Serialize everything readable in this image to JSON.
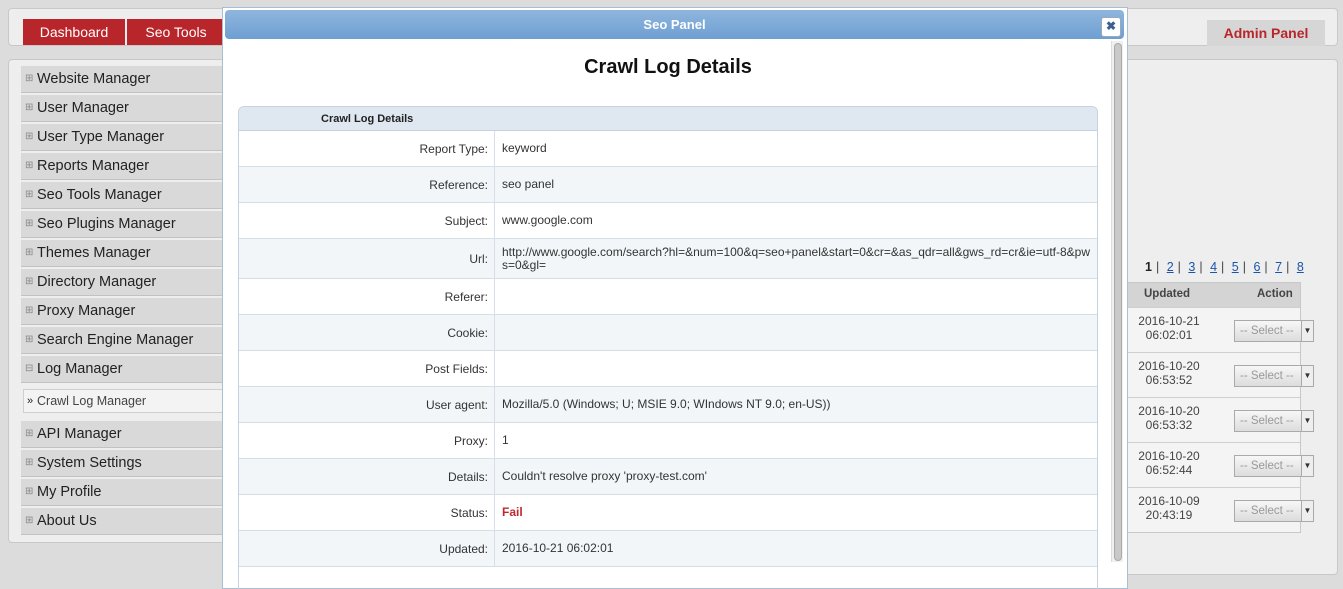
{
  "topbar": {
    "tabs": [
      {
        "label": "Dashboard"
      },
      {
        "label": "Seo Tools"
      }
    ],
    "admin_label": "Admin Panel"
  },
  "sidebar": {
    "items": [
      {
        "label": "Website Manager",
        "icon": "plus"
      },
      {
        "label": "User Manager",
        "icon": "plus"
      },
      {
        "label": "User Type Manager",
        "icon": "plus"
      },
      {
        "label": "Reports Manager",
        "icon": "plus"
      },
      {
        "label": "Seo Tools Manager",
        "icon": "plus"
      },
      {
        "label": "Seo Plugins Manager",
        "icon": "plus"
      },
      {
        "label": "Themes Manager",
        "icon": "plus"
      },
      {
        "label": "Directory Manager",
        "icon": "plus"
      },
      {
        "label": "Proxy Manager",
        "icon": "plus"
      },
      {
        "label": "Search Engine Manager",
        "icon": "plus"
      },
      {
        "label": "Log Manager",
        "icon": "minus"
      },
      {
        "label": "API Manager",
        "icon": "plus"
      },
      {
        "label": "System Settings",
        "icon": "plus"
      },
      {
        "label": "My Profile",
        "icon": "plus"
      },
      {
        "label": "About Us",
        "icon": "plus"
      }
    ],
    "sub_item": {
      "label": "Crawl Log Manager"
    }
  },
  "background_table": {
    "pager": {
      "current": "1",
      "pages": [
        "2",
        "3",
        "4",
        "5",
        "6",
        "7",
        "8"
      ],
      "separator": "|"
    },
    "headers": {
      "updated": "Updated",
      "action": "Action"
    },
    "rows": [
      {
        "date": "2016-10-21",
        "time": "06:02:01",
        "select": "-- Select --"
      },
      {
        "date": "2016-10-20",
        "time": "06:53:52",
        "select": "-- Select --"
      },
      {
        "date": "2016-10-20",
        "time": "06:53:32",
        "select": "-- Select --"
      },
      {
        "date": "2016-10-20",
        "time": "06:52:44",
        "select": "-- Select --"
      },
      {
        "date": "2016-10-09",
        "time": "20:43:19",
        "select": "-- Select --"
      }
    ]
  },
  "modal": {
    "header_title": "Seo Panel",
    "close_glyph": "✖",
    "title": "Crawl Log Details",
    "section_title": "Crawl Log Details",
    "fields": [
      {
        "label": "Report Type:",
        "value": "keyword"
      },
      {
        "label": "Reference:",
        "value": "seo panel"
      },
      {
        "label": "Subject:",
        "value": "www.google.com"
      },
      {
        "label": "Url:",
        "value": "http://www.google.com/search?hl=&num=100&q=seo+panel&start=0&cr=&as_qdr=all&gws_rd=cr&ie=utf-8&pws=0&gl="
      },
      {
        "label": "Referer:",
        "value": ""
      },
      {
        "label": "Cookie:",
        "value": ""
      },
      {
        "label": "Post Fields:",
        "value": ""
      },
      {
        "label": "User agent:",
        "value": "Mozilla/5.0 (Windows; U; MSIE 9.0; WIndows NT 9.0; en-US))"
      },
      {
        "label": "Proxy:",
        "value": "1"
      },
      {
        "label": "Details:",
        "value": "Couldn't resolve proxy 'proxy-test.com'"
      },
      {
        "label": "Status:",
        "value": "Fail"
      },
      {
        "label": "Updated:",
        "value": "2016-10-21 06:02:01"
      }
    ]
  },
  "colors": {
    "brand_red": "#b8262b",
    "modal_header": "#7aa7d6",
    "fail_text": "#c0282e"
  }
}
